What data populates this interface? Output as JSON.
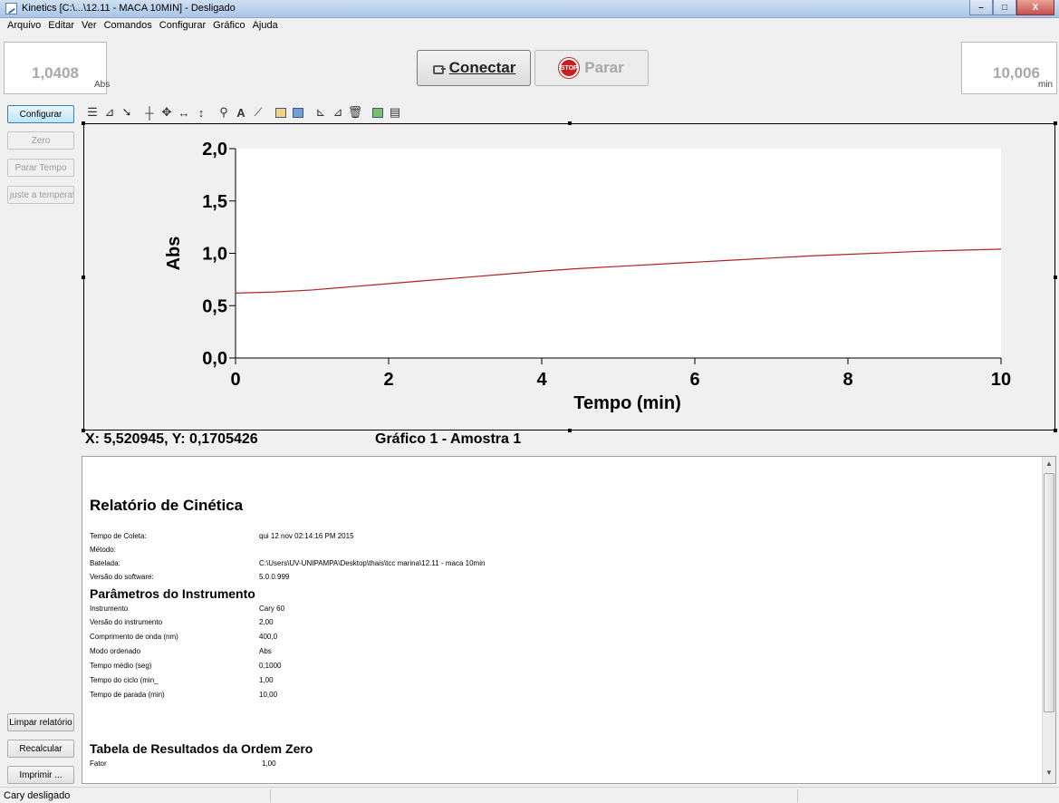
{
  "window": {
    "title": "Kinetics [C:\\...\\12.11 - MACA 10MIN] - Desligado",
    "buttons": [
      "–",
      "□",
      "X"
    ]
  },
  "menu": [
    "Arquivo",
    "Editar",
    "Ver",
    "Comandos",
    "Configurar",
    "Gráfico",
    "Ajuda"
  ],
  "readouts": {
    "abs_value": "1,0408",
    "abs_unit": "Abs",
    "time_value": "10,006",
    "time_unit": "min"
  },
  "controls": {
    "connect_label": "Conectar",
    "stop_label": "Parar",
    "stop_icon_text": "STOP"
  },
  "side": {
    "configure": "Configurar",
    "zero": "Zero",
    "stop_time": "Parar Tempo",
    "temp_adjust": "juste a temperatur",
    "clear_report": "Limpar relatório",
    "recalc": "Recalcular",
    "print": "Imprimir ..."
  },
  "toolbar_icons": [
    "autoscale-icon",
    "axes-icon",
    "pointer-icon",
    "crosshair-icon",
    "move-icon",
    "horizontal-arrows-icon",
    "vertical-cursor-icon",
    "zoom-icon",
    "text-icon",
    "label-icon",
    "overlay-icon",
    "overlay2-icon",
    "axis-edit-icon",
    "axis-edit2-icon",
    "delete-icon",
    "copy-icon",
    "print-graph-icon"
  ],
  "chart_data": {
    "type": "line",
    "title": "",
    "xlabel": "Tempo (min)",
    "ylabel": "Abs",
    "xlim": [
      0,
      10
    ],
    "ylim": [
      0,
      2
    ],
    "xticks": [
      "0",
      "2",
      "4",
      "6",
      "8",
      "10"
    ],
    "yticks": [
      "0,0",
      "0,5",
      "1,0",
      "1,5",
      "2,0"
    ],
    "grid": false,
    "line_color": "#b0202a",
    "series": [
      {
        "x": [
          0,
          0.5,
          1,
          1.5,
          2,
          2.5,
          3,
          3.5,
          4,
          4.5,
          5,
          5.5,
          6,
          6.5,
          7,
          7.5,
          8,
          8.5,
          9,
          9.5,
          10
        ],
        "y": [
          0.62,
          0.63,
          0.65,
          0.68,
          0.71,
          0.74,
          0.77,
          0.8,
          0.83,
          0.855,
          0.875,
          0.895,
          0.915,
          0.935,
          0.955,
          0.975,
          0.99,
          1.005,
          1.02,
          1.03,
          1.04
        ]
      }
    ]
  },
  "cursor_readout": "X: 5,520945, Y: 0,1705426",
  "graph_name": "Gráfico 1 - Amostra 1",
  "report": {
    "title": "Relatório de Cinética",
    "info": [
      {
        "label": "Tempo de Coleta:",
        "value": "qui 12 nov 02:14:16 PM 2015"
      },
      {
        "label": "Método:",
        "value": ""
      },
      {
        "label": "Batelada:",
        "value": "C:\\Users\\UV-UNIPAMPA\\Desktop\\thais\\tcc marina\\12.11 - maca 10min"
      },
      {
        "label": "Versão do software:",
        "value": "5.0.0.999"
      }
    ],
    "params_title": "Parâmetros do Instrumento",
    "params": [
      {
        "label": "Instrumento",
        "value": "Cary 60"
      },
      {
        "label": "Versão do instrumento",
        "value": "2,00"
      },
      {
        "label": "Comprimento de onda (nm)",
        "value": "400,0"
      },
      {
        "label": "Modo ordenado",
        "value": "Abs"
      },
      {
        "label": "Tempo médio (seg)",
        "value": "0,1000"
      },
      {
        "label": "Tempo do ciclo (min_",
        "value": "1,00"
      },
      {
        "label": "Tempo de parada (min)",
        "value": "10,00"
      }
    ],
    "table_title": "Tabela de Resultados da Ordem Zero",
    "table_rows": [
      {
        "label": "Fator",
        "value": "1,00"
      }
    ]
  },
  "status": "Cary desligado"
}
